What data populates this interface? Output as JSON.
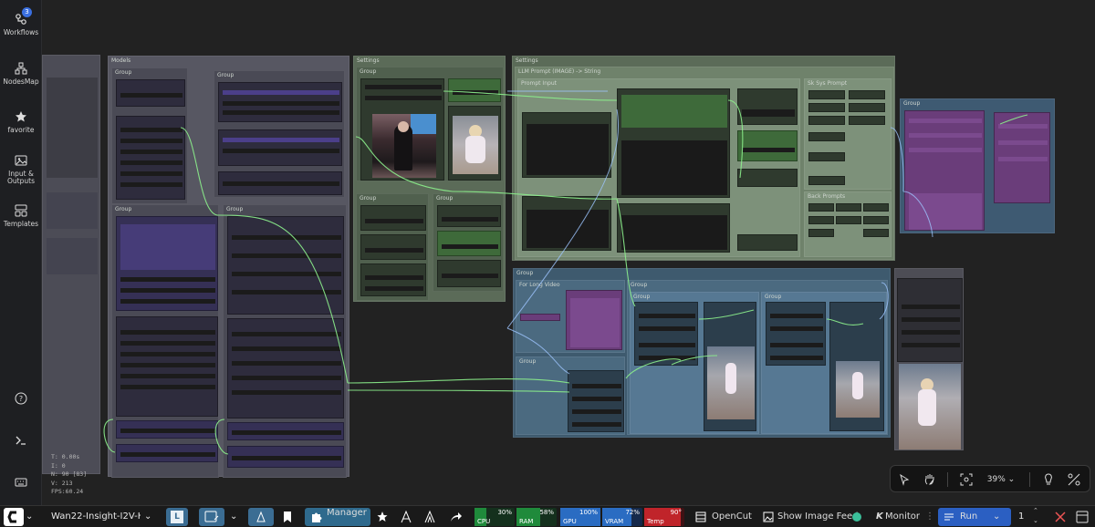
{
  "sidebar": {
    "items": [
      {
        "label": "Workflows",
        "icon": "workflows-icon",
        "badge": "3"
      },
      {
        "label": "NodesMap",
        "icon": "nodesmap-icon"
      },
      {
        "label": "favorite",
        "icon": "star-icon"
      },
      {
        "label_line1": "Input &",
        "label_line2": "Outputs",
        "icon": "image-icon"
      },
      {
        "label": "Templates",
        "icon": "templates-icon"
      }
    ],
    "bottom_icons": [
      "help-icon",
      "terminal-icon",
      "keyboard-icon"
    ]
  },
  "canvas": {
    "groups": {
      "models": "Models",
      "group": "Group",
      "settings": "Settings",
      "llm_prompt": "LLM Prompt  (IMAGE) -> String",
      "prompt_input": "Prompt Input",
      "sk_sys_prompt": "Sk Sys Prompt",
      "back_prompts": "Back Prompts",
      "for_long_video": "For Long Video"
    },
    "stats": {
      "t": "T: 0.00s",
      "i": "I: 0",
      "n": "N: 90 [83]",
      "v": "V: 213",
      "fps": "FPS:60.24"
    },
    "toolbar": {
      "zoom": "39%",
      "icons": [
        "select-icon",
        "hand-icon",
        "fit-view-icon",
        "zoom-dropdown",
        "bulb-icon",
        "link-visibility-icon"
      ]
    }
  },
  "bottombar": {
    "workflow_name": "Wan22-Insight-I2V-H...",
    "manager": "Manager",
    "meters": [
      {
        "label": "CPU",
        "value": "30%",
        "fill": 0.3,
        "color": "#1f8a3b"
      },
      {
        "label": "RAM",
        "value": "58%",
        "fill": 0.58,
        "color": "#1f8a3b"
      },
      {
        "label": "GPU",
        "value": "100%",
        "fill": 1.0,
        "color": "#2a6cc2"
      },
      {
        "label": "VRAM",
        "value": "72%",
        "fill": 0.72,
        "color": "#2a6cc2"
      },
      {
        "label": "Temp",
        "value": "90°",
        "fill": 0.9,
        "color": "#c0242a"
      }
    ],
    "opencut": "OpenCut",
    "show_image_feed": "Show Image Feed",
    "monitor": "Monitor",
    "run": "Run",
    "batch_count": "1"
  }
}
